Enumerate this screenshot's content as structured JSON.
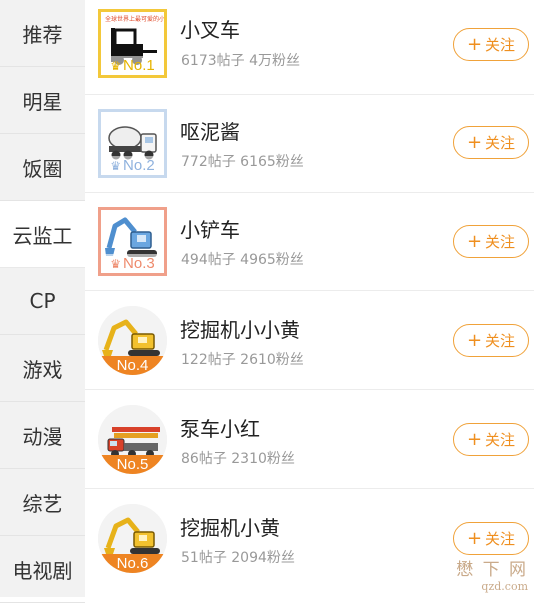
{
  "sidebar": {
    "items": [
      {
        "label": "推荐"
      },
      {
        "label": "明星"
      },
      {
        "label": "饭圈"
      },
      {
        "label": "云监工",
        "active": true
      },
      {
        "label": "CP"
      },
      {
        "label": "游戏"
      },
      {
        "label": "动漫"
      },
      {
        "label": "综艺"
      },
      {
        "label": "电视剧"
      }
    ]
  },
  "list": {
    "follow_label": "关注",
    "follow_icon": "plus-icon",
    "crown_icon": "crown-icon",
    "accent_color": "#ef8f1f",
    "items": [
      {
        "name": "小叉车",
        "stats": "6173帖子 4万粉丝",
        "rank": "No.1",
        "avatar_caption": "全球世界上最可爱的小叉车"
      },
      {
        "name": "呕泥酱",
        "stats": "772帖子 6165粉丝",
        "rank": "No.2"
      },
      {
        "name": "小铲车",
        "stats": "494帖子 4965粉丝",
        "rank": "No.3"
      },
      {
        "name": "挖掘机小小黄",
        "stats": "122帖子 2610粉丝",
        "rank": "No.4"
      },
      {
        "name": "泵车小红",
        "stats": "86帖子 2310粉丝",
        "rank": "No.5"
      },
      {
        "name": "挖掘机小黄",
        "stats": "51帖子 2094粉丝",
        "rank": "No.6"
      }
    ]
  },
  "watermark": {
    "main": "懋 下 网",
    "sub": "qzd.com"
  }
}
